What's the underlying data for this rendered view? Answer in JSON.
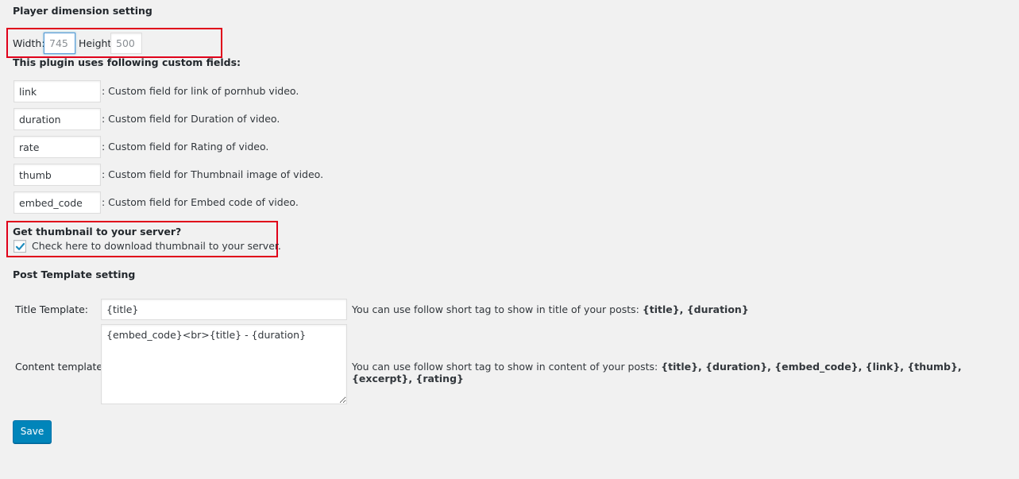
{
  "player_dimension": {
    "title": "Player dimension setting",
    "width_label": "Width:",
    "width_value": "745",
    "height_label": "Height",
    "height_value": "500"
  },
  "custom_fields": {
    "title": "This plugin uses following custom fields:",
    "items": [
      {
        "value": "link",
        "desc": ": Custom field for link of pornhub video."
      },
      {
        "value": "duration",
        "desc": ": Custom field for Duration of video."
      },
      {
        "value": "rate",
        "desc": ": Custom field for Rating of video."
      },
      {
        "value": "thumb",
        "desc": ": Custom field for Thumbnail image of video."
      },
      {
        "value": "embed_code",
        "desc": ": Custom field for Embed code of video."
      }
    ]
  },
  "thumbnail": {
    "title": "Get thumbnail to your server?",
    "checkbox_label": "Check here to download thumbnail to your server.",
    "checked": true
  },
  "post_template": {
    "title": "Post Template setting",
    "title_template_label": "Title Template:",
    "title_template_value": "{title}",
    "title_hint_prefix": "You can use follow short tag to show in title of your posts: ",
    "title_hint_tags": "{title}, {duration}",
    "content_template_label": "Content template:",
    "content_template_value": "{embed_code}<br>{title} - {duration}",
    "content_hint_prefix": "You can use follow short tag to show in content of your posts: ",
    "content_hint_tags": "{title}, {duration}, {embed_code}, {link}, {thumb}, {excerpt}, {rating}"
  },
  "save_label": "Save",
  "colors": {
    "highlight_border": "#e0001a",
    "primary_button": "#0085ba",
    "background": "#f1f1f1"
  }
}
